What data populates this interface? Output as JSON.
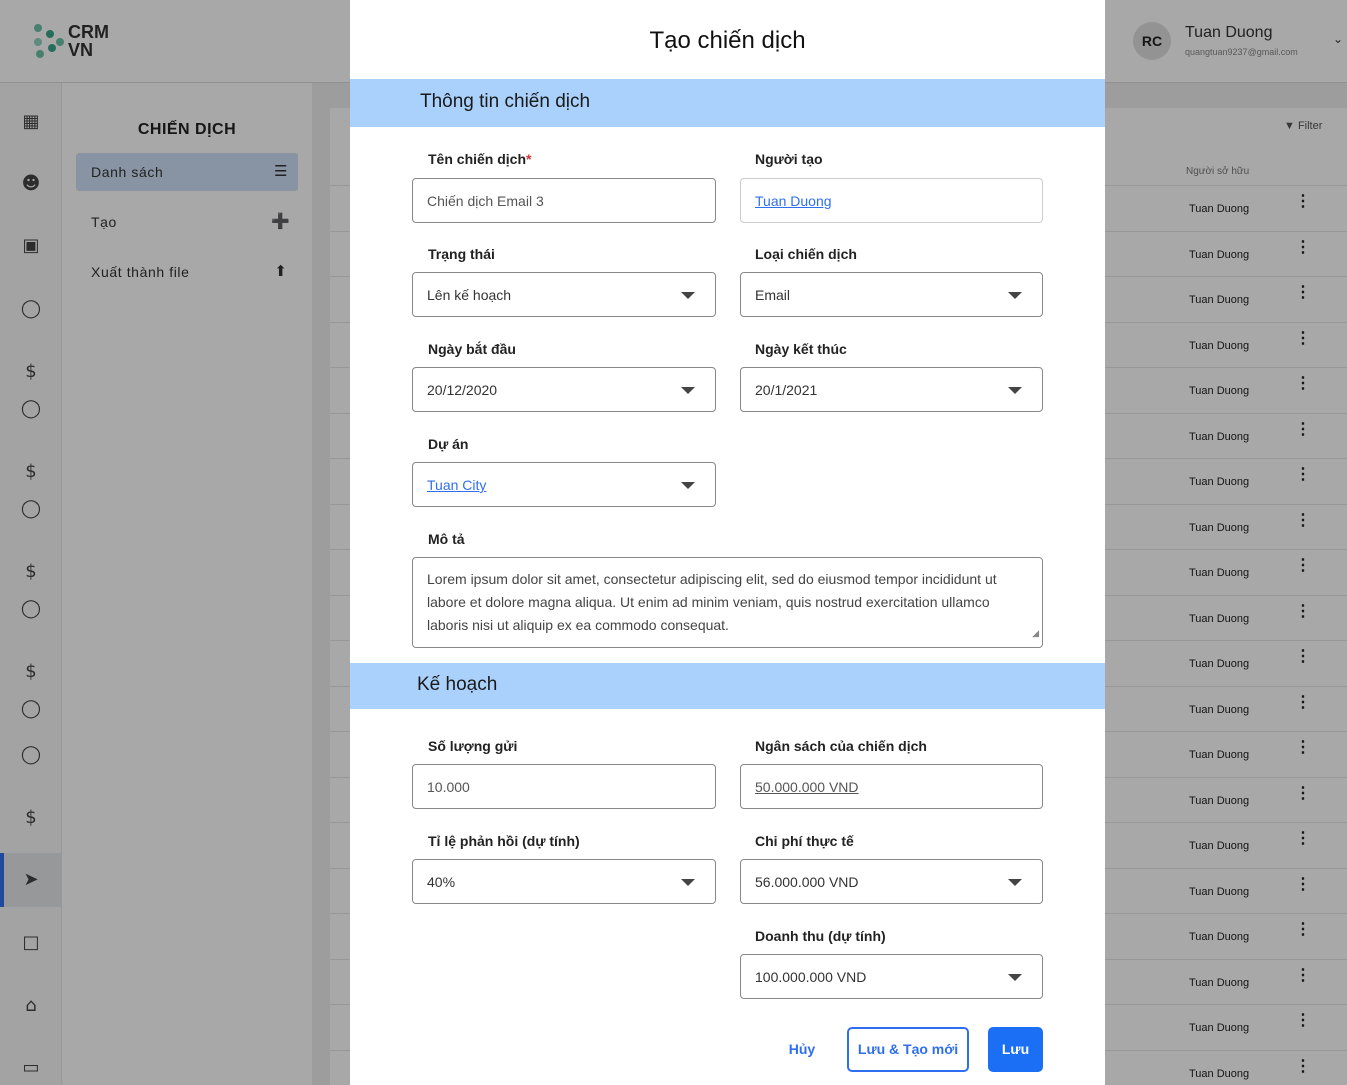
{
  "app": {
    "logo_text": "CRM\nVN"
  },
  "user": {
    "initials": "RC",
    "name": "Tuan Duong",
    "email": "quangtuan9237@gmail.com"
  },
  "subnav": {
    "title": "CHIẾN DỊCH",
    "items": [
      {
        "label": "Danh sách",
        "icon": "list-icon"
      },
      {
        "label": "Tạo",
        "icon": "plus-circle-icon"
      },
      {
        "label": "Xuất thành file",
        "icon": "upload-icon"
      }
    ]
  },
  "list": {
    "filter": "Filter",
    "owner_header": "Người sở hữu",
    "owner_value": "Tuan Duong"
  },
  "modal": {
    "title": "Tạo chiến dịch",
    "section1": "Thông tin chiến dịch",
    "section2": "Kế hoạch",
    "fields": {
      "name": {
        "label": "Tên chiến dịch",
        "required": "*",
        "placeholder": "Chiến dịch Email 3"
      },
      "creator": {
        "label": "Người tạo",
        "value": "Tuan Duong"
      },
      "status": {
        "label": "Trạng thái",
        "value": "Lên kế hoạch"
      },
      "type": {
        "label": "Loại chiến dịch",
        "value": "Email"
      },
      "start": {
        "label": "Ngày bắt đầu",
        "value": "20/12/2020"
      },
      "end": {
        "label": "Ngày kết thúc",
        "value": "20/1/2021"
      },
      "project": {
        "label": "Dự án",
        "value": "Tuan City"
      },
      "desc": {
        "label": "Mô tả",
        "value": "Lorem ipsum dolor sit amet, consectetur adipiscing elit, sed do eiusmod tempor incididunt ut labore et dolore magna aliqua. Ut enim ad minim veniam, quis nostrud exercitation ullamco laboris nisi ut aliquip ex ea commodo consequat."
      },
      "send_count": {
        "label": "Số lượng gửi",
        "value": "10.000"
      },
      "budget": {
        "label": "Ngân sách của chiến dịch",
        "value": "50.000.000 VND"
      },
      "response_rate": {
        "label": "Tỉ lệ phản hồi (dự tính)",
        "value": "40%"
      },
      "actual_cost": {
        "label": "Chi phí thực tế",
        "value": "56.000.000 VND"
      },
      "revenue": {
        "label": "Doanh thu (dự tính)",
        "value": "100.000.000 VND"
      }
    },
    "buttons": {
      "cancel": "Hủy",
      "save_new": "Lưu & Tạo mới",
      "save": "Lưu"
    }
  },
  "colors": {
    "accent": "#1a6ff5",
    "section_bg": "#a9d1fc",
    "active_nav": "#cfe1f7"
  }
}
